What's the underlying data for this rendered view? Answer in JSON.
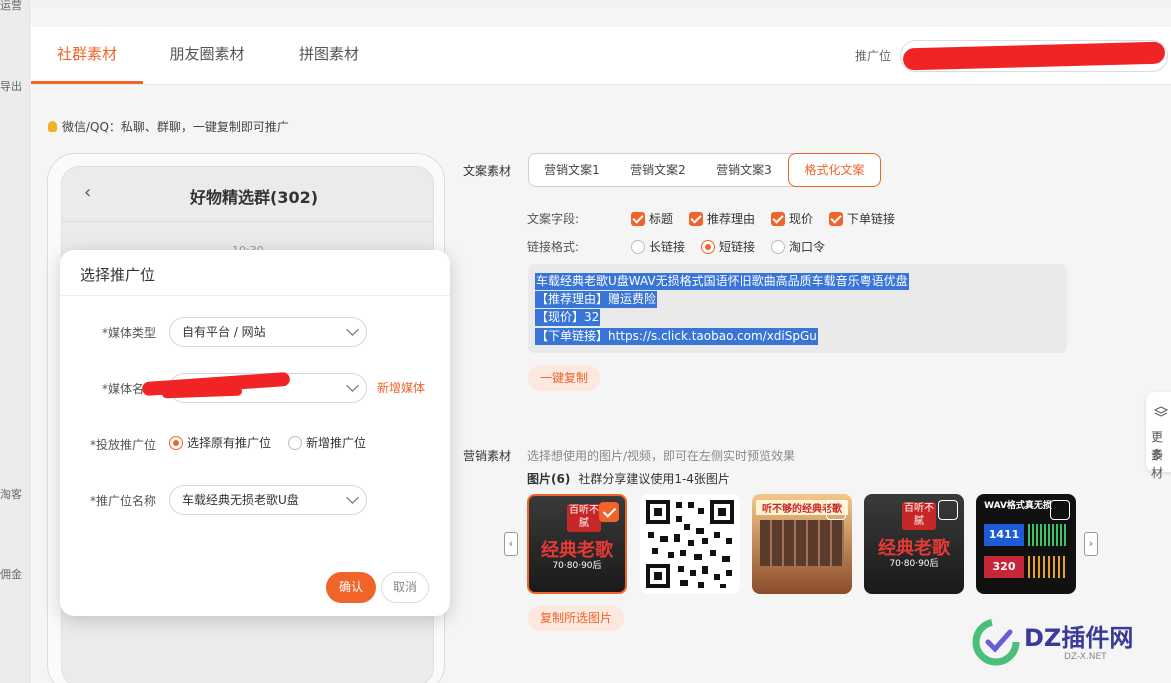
{
  "left_strip": {
    "t1": "运营",
    "t2": "导出",
    "t3": "淘客",
    "t4": "佣金"
  },
  "tabs": [
    {
      "label": "社群素材",
      "active": true
    },
    {
      "label": "朋友圈素材",
      "active": false
    },
    {
      "label": "拼图素材",
      "active": false
    }
  ],
  "promo_position_label": "推广位",
  "hint_text": "微信/QQ：私聊、群聊，一键复制即可推广",
  "phone": {
    "back_icon": "‹",
    "group_title": "好物精选群(302)",
    "time": "10:30"
  },
  "modal": {
    "title": "选择推广位",
    "media_type_label": "*媒体类型",
    "media_type_value": "自有平台 / 网站",
    "media_name_label": "*媒体名称",
    "add_media_link": "新增媒体",
    "placement_label": "*投放推广位",
    "placement_options": [
      {
        "label": "选择原有推广位",
        "checked": true
      },
      {
        "label": "新增推广位",
        "checked": false
      }
    ],
    "position_name_label": "*推广位名称",
    "position_name_value": "车载经典无损老歌U盘",
    "confirm_label": "确认",
    "cancel_label": "取消"
  },
  "copy_material": {
    "section_label": "文案素材",
    "segments": [
      {
        "label": "营销文案1",
        "active": false
      },
      {
        "label": "营销文案2",
        "active": false
      },
      {
        "label": "营销文案3",
        "active": false
      },
      {
        "label": "格式化文案",
        "active": true
      }
    ],
    "fields_label": "文案字段:",
    "fields": [
      {
        "label": "标题",
        "checked": true
      },
      {
        "label": "推荐理由",
        "checked": true
      },
      {
        "label": "现价",
        "checked": true
      },
      {
        "label": "下单链接",
        "checked": true
      }
    ],
    "link_format_label": "链接格式:",
    "link_formats": [
      {
        "label": "长链接",
        "checked": false
      },
      {
        "label": "短链接",
        "checked": true
      },
      {
        "label": "淘口令",
        "checked": false
      }
    ],
    "lines": [
      "车载经典老歌U盘WAV无损格式国语怀旧歌曲高品质车载音乐粤语优盘",
      "【推荐理由】赠运费险",
      "【现价】32",
      "【下单链接】https://s.click.taobao.com/xdiSpGu"
    ],
    "copy_button": "一键复制"
  },
  "marketing_material": {
    "section_label": "营销素材",
    "hint": "选择想使用的图片/视频，即可在左侧实时预览效果",
    "images_label": "图片(6)",
    "images_hint": "社群分享建议使用1-4张图片",
    "thumbs": [
      {
        "caption_top": "百听不腻",
        "caption_main": "经典老歌",
        "caption_sub": "70·80·90后",
        "selected": true
      },
      {
        "caption_top": "",
        "caption_main": "",
        "caption_sub": "",
        "selected": false
      },
      {
        "caption_top": "听不够的经典老歌",
        "caption_main": "",
        "caption_sub": "",
        "selected": false
      },
      {
        "caption_top": "百听不腻",
        "caption_main": "经典老歌",
        "caption_sub": "70·80·90后",
        "selected": false
      },
      {
        "caption_top": "WAV格式真无损",
        "caption_main": "1411",
        "caption_sub": "320",
        "selected": false
      }
    ],
    "copy_selected_button": "复制所选图片",
    "prev_icon": "‹",
    "next_icon": "›"
  },
  "side_tab": {
    "line1": "更多",
    "line2": "素材"
  },
  "brand": {
    "name": "DZ插件网",
    "url": "DZ-X.NET"
  },
  "colors": {
    "accent": "#f0642a",
    "selection": "#3875d7",
    "redaction": "#f02424"
  }
}
